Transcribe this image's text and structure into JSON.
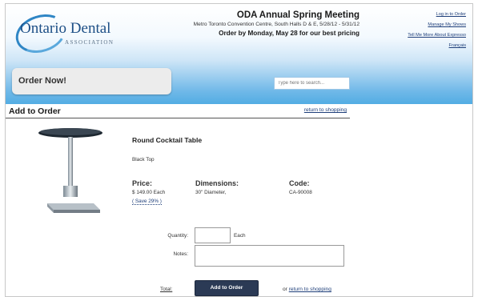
{
  "header": {
    "logo_main": "Ontario Dental",
    "logo_sub": "ASSOCIATION",
    "event_title": "ODA Annual Spring Meeting",
    "event_venue": "Metro Toronto Convention Centre, South Halls D & E, 5/28/12 - 5/31/12",
    "event_order": "Order by Monday, May 28 for our best pricing",
    "links": [
      "Log in to Order",
      "Manage My Shows",
      "Tell Me More About Expresso",
      "Français"
    ]
  },
  "order_box": {
    "label": "Order Now!"
  },
  "search": {
    "placeholder": "Type here to search..."
  },
  "section": {
    "title": "Add to Order",
    "return_link": "return to shopping"
  },
  "product": {
    "name": "Round Cocktail Table",
    "description": "Black Top",
    "price_label": "Price:",
    "price_value": "$ 149.00 Each",
    "save_text": "( Save 29% )",
    "dimensions_label": "Dimensions:",
    "dimensions_value": "30\" Diameter,",
    "code_label": "Code:",
    "code_value": "CA-90008"
  },
  "form": {
    "quantity_label": "Quantity:",
    "quantity_value": "",
    "each_label": "Each",
    "notes_label": "Notes:",
    "notes_value": "",
    "total_label": "Total:",
    "add_button": "Add to Order",
    "or_text": "or",
    "return_link": "return to shopping"
  },
  "colors": {
    "header_blue": "#38a2df",
    "button_navy": "#2b3a55",
    "link_blue": "#1f3f7a"
  }
}
